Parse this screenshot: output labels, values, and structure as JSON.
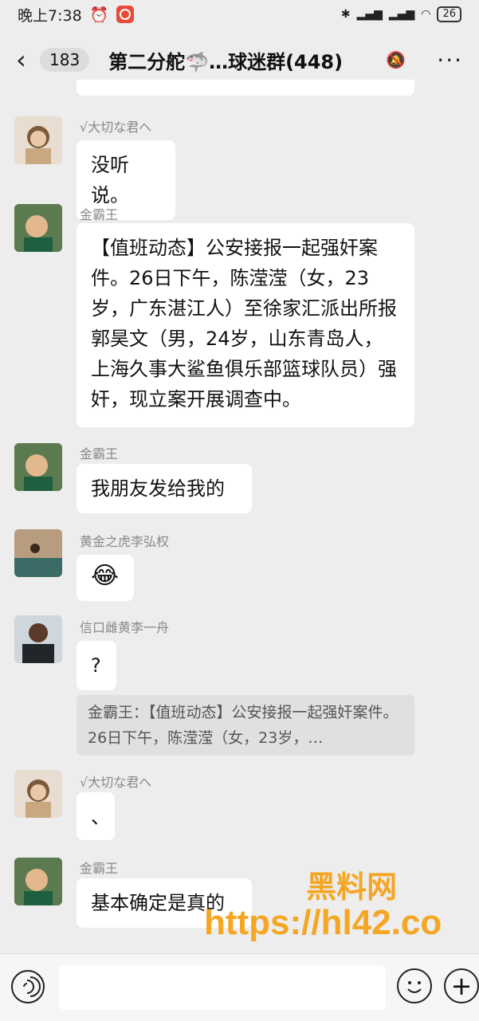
{
  "status": {
    "time": "晚上7:38",
    "battery": "26"
  },
  "header": {
    "unread_count": "183",
    "title": "第二分舵🦈…球迷群(448)"
  },
  "messages": [
    {
      "sender": "√大切な君へ",
      "text": "没听说。"
    },
    {
      "sender": "金霸王",
      "text": "【值班动态】公安接报一起强奸案件。26日下午，陈滢滢（女，23岁，广东湛江人）至徐家汇派出所报郭昊文（男，24岁，山东青岛人，上海久事大鲨鱼俱乐部篮球队员）强奸，现立案开展调查中。"
    },
    {
      "sender": "金霸王",
      "text": "我朋友发给我的"
    },
    {
      "sender": "黄金之虎李弘权",
      "text": "😂"
    },
    {
      "sender": "信口雌黄李一舟",
      "text": "?",
      "quote": "金霸王：【值班动态】公安接报一起强奸案件。26日下午，陈滢滢（女，23岁，…"
    },
    {
      "sender": "√大切な君へ",
      "text": "、"
    },
    {
      "sender": "金霸王",
      "text": "基本确定是真的"
    }
  ],
  "watermark": {
    "line1": "黑料网",
    "line2": "https://hl42.co"
  }
}
